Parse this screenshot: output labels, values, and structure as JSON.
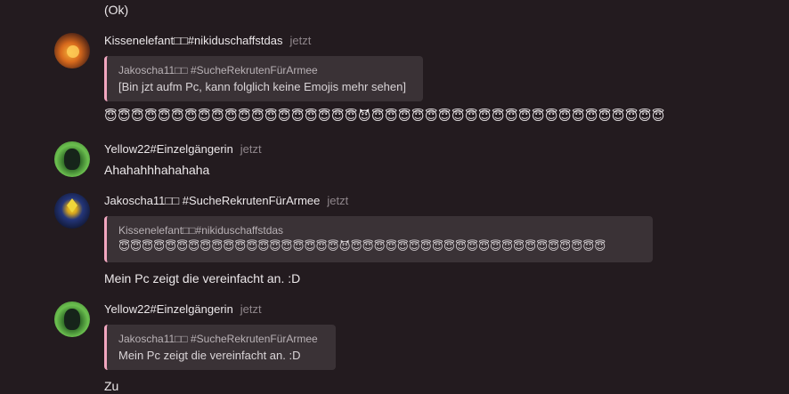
{
  "chat": {
    "continuation_text": "(Ok)",
    "messages": [
      {
        "username": "Kissenelefant□□#nikiduschaffstdas",
        "time": "jetzt",
        "avatar": "cat-avatar",
        "quote": {
          "author": "Jakoscha11□□ #SucheRekrutenFürArmee",
          "text": "[Bin jzt aufm Pc, kann folglich keine Emojis mehr sehen]"
        },
        "text": "😇😇😇😇😇😇😇😇😇😇😇😇😇😇😇😇😇😇😇😈😇😇😇😇😇😇😇😇😇😇😇😇😇😇😇😇😇😇😇😇😇😇"
      },
      {
        "username": "Yellow22#Einzelgängerin",
        "time": "jetzt",
        "avatar": "green-cat-avatar",
        "text": "Ahahahhhahahaha"
      },
      {
        "username": "Jakoscha11□□ #SucheRekrutenFürArmee",
        "time": "jetzt",
        "avatar": "emblem-avatar",
        "quote": {
          "author": "Kissenelefant□□#nikiduschaffstdas",
          "text": "😇😇😇😇😇😇😇😇😇😇😇😇😇😇😇😇😇😇😇😈😇😇😇😇😇😇😇😇😇😇😇😇😇😇😇😇😇😇😇😇😇😇"
        },
        "text": "Mein Pc zeigt die vereinfacht an. :D"
      },
      {
        "username": "Yellow22#Einzelgängerin",
        "time": "jetzt",
        "avatar": "green-cat-avatar",
        "quote": {
          "author": "Jakoscha11□□ #SucheRekrutenFürArmee",
          "text": "Mein Pc zeigt die vereinfacht an. :D"
        },
        "text": "Zu"
      }
    ]
  },
  "colors": {
    "background": "#231b1f",
    "quote_background": "#3a3236",
    "quote_accent": "#f2a7c0",
    "timestamp": "#8f868b"
  }
}
